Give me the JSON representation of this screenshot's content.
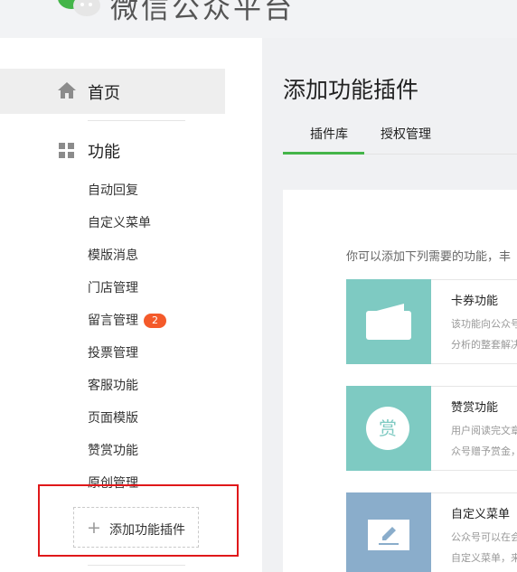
{
  "header": {
    "brand": "微信公众平台"
  },
  "sidebar": {
    "home_label": "首页",
    "function_label": "功能",
    "items": [
      {
        "label": "自动回复"
      },
      {
        "label": "自定义菜单"
      },
      {
        "label": "模版消息"
      },
      {
        "label": "门店管理"
      },
      {
        "label": "留言管理",
        "badge": "2"
      },
      {
        "label": "投票管理"
      },
      {
        "label": "客服功能"
      },
      {
        "label": "页面模版"
      },
      {
        "label": "赞赏功能"
      },
      {
        "label": "原创管理"
      }
    ],
    "add_plugin_label": "添加功能插件"
  },
  "main": {
    "title": "添加功能插件",
    "tabs": [
      {
        "label": "插件库",
        "active": true
      },
      {
        "label": "授权管理",
        "active": false
      }
    ],
    "intro": "你可以添加下列需要的功能，丰",
    "cards": [
      {
        "title": "卡券功能",
        "desc": [
          "该功能向公众号",
          "分析的整套解决"
        ],
        "icon": "wallet-icon",
        "color": "#7ecac2"
      },
      {
        "title": "赞赏功能",
        "desc": [
          "用户阅读完文章",
          "众号赠予赏金，"
        ],
        "icon": "reward-icon",
        "icon_text": "赏",
        "color": "#7ecac2"
      },
      {
        "title": "自定义菜单",
        "desc": [
          "公众号可以在会",
          "自定义菜单，来"
        ],
        "icon": "menu-edit-icon",
        "color": "#8aadcb"
      }
    ]
  },
  "colors": {
    "accent_green": "#44b549",
    "badge_red": "#f45a2a",
    "highlight_red": "#e0181a"
  }
}
